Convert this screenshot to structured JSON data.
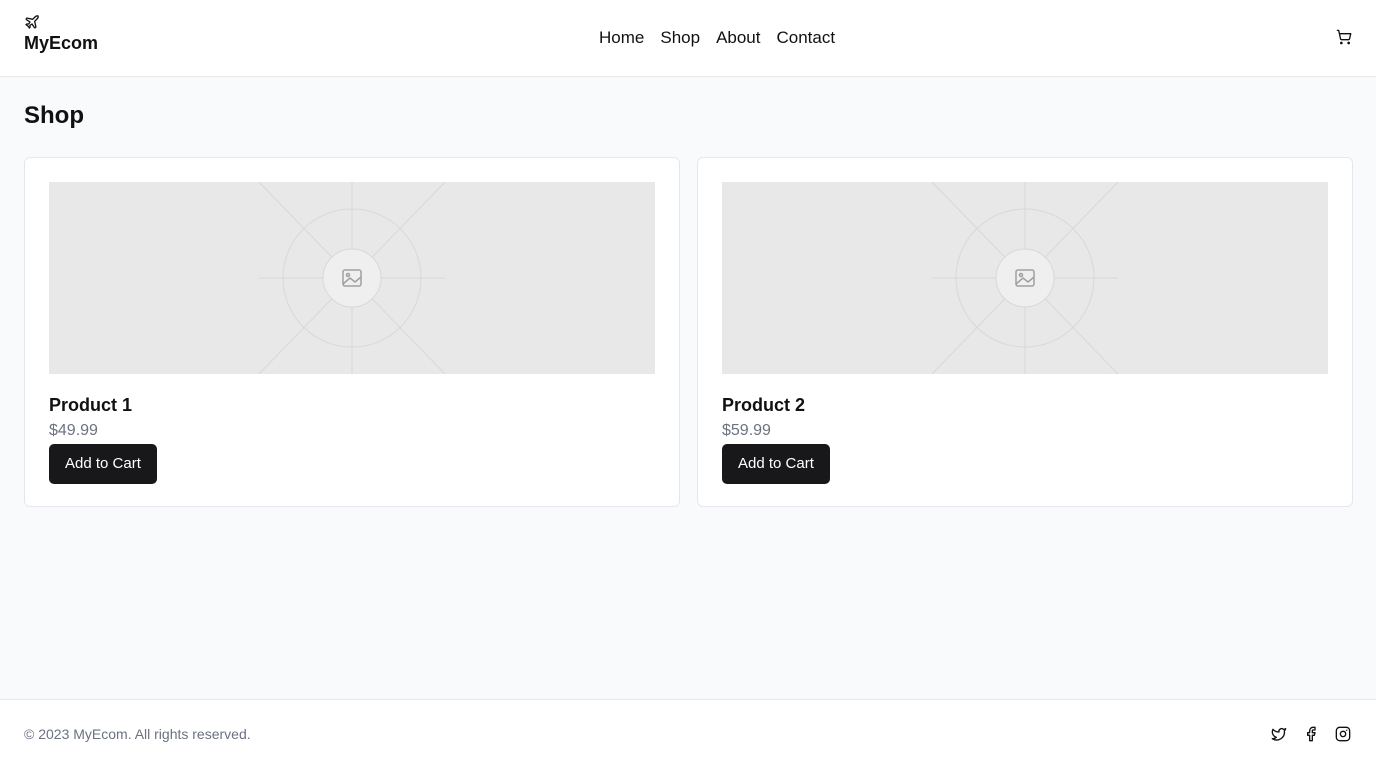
{
  "header": {
    "brand": {
      "name": "MyEcom",
      "icon": "plane-icon"
    },
    "nav": [
      {
        "label": "Home"
      },
      {
        "label": "Shop"
      },
      {
        "label": "About"
      },
      {
        "label": "Contact"
      }
    ],
    "cart_icon": "cart-icon"
  },
  "main": {
    "title": "Shop",
    "products": [
      {
        "name": "Product 1",
        "price": "$49.99",
        "button": "Add to Cart",
        "image_icon": "image-placeholder-icon"
      },
      {
        "name": "Product 2",
        "price": "$59.99",
        "button": "Add to Cart",
        "image_icon": "image-placeholder-icon"
      }
    ]
  },
  "footer": {
    "copyright": "© 2023 MyEcom. All rights reserved.",
    "social": [
      "twitter-icon",
      "facebook-icon",
      "instagram-icon"
    ]
  },
  "colors": {
    "background": "#f9fafb",
    "surface": "#ffffff",
    "button": "#18181b",
    "muted_text": "#6b7280",
    "border": "#e5e7eb",
    "placeholder": "#e8e8e8"
  }
}
